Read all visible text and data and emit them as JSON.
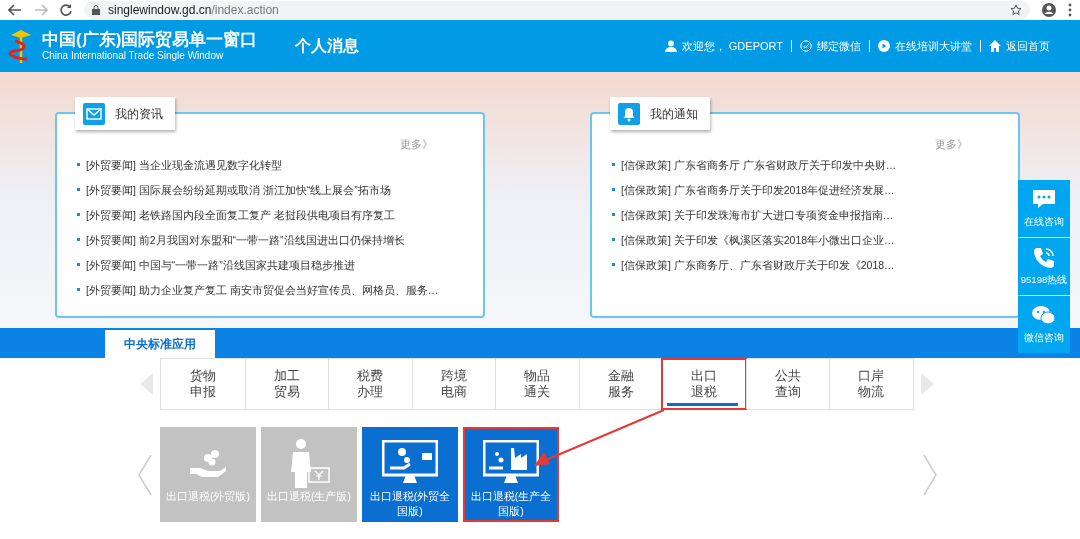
{
  "browser": {
    "url_host": "singlewindow.gd.cn",
    "url_path": "/index.action"
  },
  "header": {
    "title": "中国(广东)国际贸易单一窗口",
    "subtitle": "China International Trade Single Window",
    "page_title": "个人消息",
    "links": [
      {
        "kind": "user",
        "label": "欢迎您， GDEPORT"
      },
      {
        "kind": "check",
        "label": "绑定微信"
      },
      {
        "kind": "play",
        "label": "在线培训大讲堂"
      },
      {
        "kind": "home",
        "label": "返回首页"
      }
    ]
  },
  "panels": [
    {
      "kind": "mail",
      "title": "我的资讯",
      "more": "更多》",
      "items": [
        "[外贸要闻] 当企业现金流遇见数字化转型",
        "[外贸要闻] 国际展会纷纷延期或取消 浙江加快“线上展会”拓市场",
        "[外贸要闻] 老铁路国内段全面复工复产 老挝段供电项目有序复工",
        "[外贸要闻] 前2月我国对东盟和“一带一路”沿线国进出口仍保持增长",
        "[外贸要闻] 中国与“一带一路”沿线国家共建项目稳步推进",
        "[外贸要闻] 助力企业复产复工 南安市贸促会当好宣传员、网格员、服务…"
      ]
    },
    {
      "kind": "bell",
      "title": "我的通知",
      "more": "更多》",
      "items": [
        "[信保政策] 广东省商务厅 广东省财政厅关于印发中央财…",
        "[信保政策] 广东省商务厅关于印发2018年促进经济发展…",
        "[信保政策] 关于印发珠海市扩大进口专项资金申报指南…",
        "[信保政策] 关于印发《枫溪区落实2018年小微出口企业…",
        "[信保政策] 广东商务厅、广东省财政厅关于印发《2018…"
      ]
    }
  ],
  "side_buttons": [
    {
      "kind": "chat",
      "label": "在线咨询"
    },
    {
      "kind": "phone",
      "label": "95198热线"
    },
    {
      "kind": "wechat",
      "label": "微信咨询"
    }
  ],
  "app_tab": {
    "label": "中央标准应用"
  },
  "categories": [
    {
      "label": "货物申报",
      "selected": false,
      "annotated": false
    },
    {
      "label": "加工贸易",
      "selected": false,
      "annotated": false
    },
    {
      "label": "税费办理",
      "selected": false,
      "annotated": false
    },
    {
      "label": "跨境电商",
      "selected": false,
      "annotated": false
    },
    {
      "label": "物品通关",
      "selected": false,
      "annotated": false
    },
    {
      "label": "金融服务",
      "selected": false,
      "annotated": false
    },
    {
      "label": "出口退税",
      "selected": true,
      "annotated": true
    },
    {
      "label": "公共查询",
      "selected": false,
      "annotated": false
    },
    {
      "label": "口岸物流",
      "selected": false,
      "annotated": false
    }
  ],
  "apps": [
    {
      "kind": "hand",
      "label": "出口退税(外贸版)",
      "enabled": false,
      "annotated": false
    },
    {
      "kind": "person",
      "label": "出口退税(生产版)",
      "enabled": false,
      "annotated": false
    },
    {
      "kind": "monitor-coins",
      "label": "出口退税(外贸全国版)",
      "enabled": true,
      "annotated": false
    },
    {
      "kind": "monitor-factory",
      "label": "出口退税(生产全国版)",
      "enabled": true,
      "annotated": true
    }
  ]
}
